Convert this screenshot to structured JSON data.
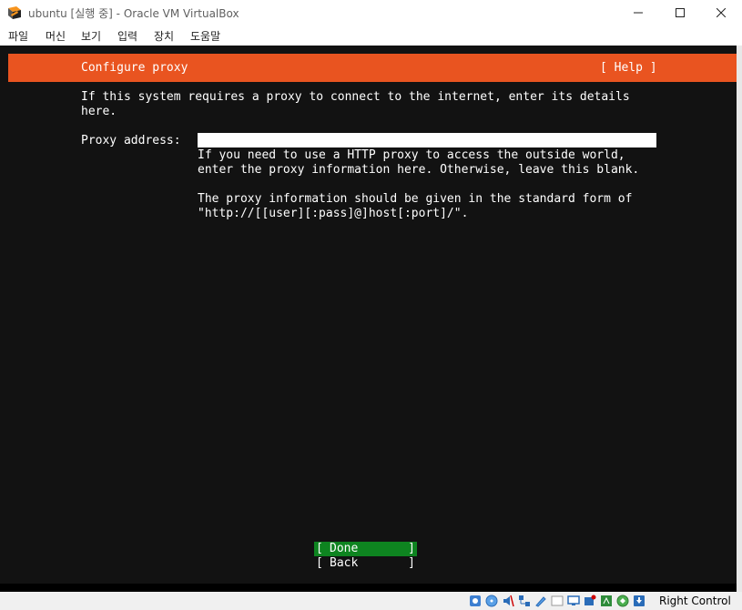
{
  "window": {
    "title": "ubuntu [실행 중] - Oracle VM VirtualBox"
  },
  "menu": [
    "파일",
    "머신",
    "보기",
    "입력",
    "장치",
    "도움말"
  ],
  "installer": {
    "header_title": "Configure proxy",
    "header_help": "[ Help ]",
    "intro_line1": "If this system requires a proxy to connect to the internet, enter its details",
    "intro_line2": "here.",
    "proxy_label": "Proxy address:",
    "proxy_value": "",
    "help_line1": "If you need to use a HTTP proxy to access the outside world,",
    "help_line2": "enter the proxy information here. Otherwise, leave this blank.",
    "help_line3": "The proxy information should be given in the standard form of",
    "help_line4": "\"http://[[user][:pass]@]host[:port]/\".",
    "done_label": "Done",
    "back_label": "Back",
    "bracket_open": "[",
    "bracket_close": "]"
  },
  "statusbar": {
    "host_key": "Right Control",
    "icons": [
      "hard-disk-icon",
      "optical-drive-icon",
      "audio-icon",
      "network-icon",
      "usb-icon",
      "shared-folders-icon",
      "display-icon",
      "video-capture-icon",
      "mouse-integration-icon",
      "keyboard-capture-icon"
    ]
  },
  "colors": {
    "ubuntu_orange": "#e95420",
    "done_green": "#0e8420",
    "terminal_bg": "#121212"
  }
}
